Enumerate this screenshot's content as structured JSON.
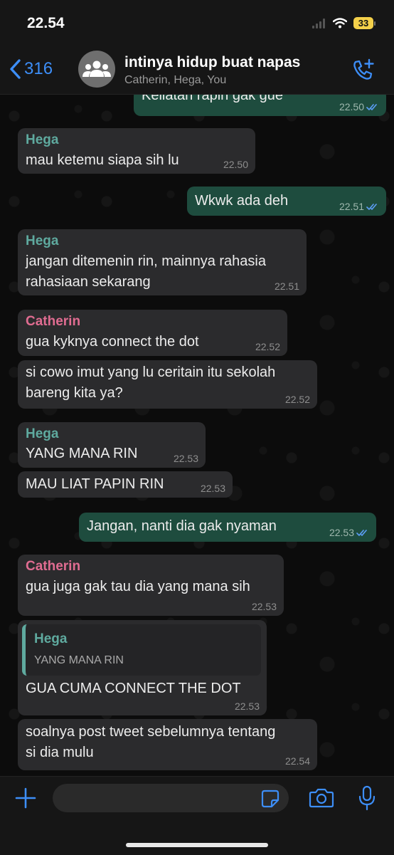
{
  "status": {
    "time": "22.54",
    "battery": "33"
  },
  "header": {
    "back_count": "316",
    "title": "intinya hidup buat napas",
    "subtitle": "Catherin, Hega, You"
  },
  "messages": [
    {
      "dir": "out",
      "lines": [
        "Keliatan rapih gak gue"
      ],
      "time": "22.50"
    },
    {
      "dir": "in",
      "sender": "Hega",
      "lines": [
        "mau ketemu siapa sih lu"
      ],
      "time": "22.50"
    },
    {
      "dir": "out",
      "lines": [
        "Wkwk ada deh"
      ],
      "time": "22.51"
    },
    {
      "dir": "in",
      "sender": "Hega",
      "lines": [
        "jangan ditemenin rin, mainnya rahasia",
        "rahasiaan sekarang"
      ],
      "time": "22.51"
    },
    {
      "dir": "in",
      "sender": "Catherin",
      "lines": [
        "gua kyknya connect the dot"
      ],
      "time": "22.52"
    },
    {
      "dir": "in",
      "lines": [
        "si cowo imut yang lu ceritain itu sekolah",
        "bareng kita ya?"
      ],
      "time": "22.52"
    },
    {
      "dir": "in",
      "sender": "Hega",
      "lines": [
        "YANG MANA RIN"
      ],
      "time": "22.53"
    },
    {
      "dir": "in",
      "lines": [
        "MAU LIAT PAPIN RIN"
      ],
      "time": "22.53"
    },
    {
      "dir": "out",
      "lines": [
        "Jangan, nanti dia gak nyaman"
      ],
      "time": "22.53"
    },
    {
      "dir": "in",
      "sender": "Catherin",
      "lines": [
        "gua juga gak tau dia yang mana sih"
      ],
      "time": "22.53"
    },
    {
      "dir": "in",
      "quote": {
        "sender": "Hega",
        "text": "YANG MANA RIN"
      },
      "lines": [
        "GUA CUMA CONNECT THE DOT"
      ],
      "time": "22.53"
    },
    {
      "dir": "in",
      "lines": [
        "soalnya post tweet sebelumnya tentang",
        "si dia mulu"
      ],
      "time": "22.54"
    }
  ],
  "composer": {
    "placeholder": ""
  },
  "colors": {
    "accent": "#3d8ef7",
    "outgoing": "#1e4c3e",
    "incoming": "#2b2b2d",
    "hega": "#5faa9f",
    "catherin": "#e06c91"
  },
  "icons": [
    "signal-icon",
    "wifi-icon",
    "battery-icon",
    "back-chevron-icon",
    "group-avatar-icon",
    "add-call-icon",
    "double-check-icon",
    "plus-icon",
    "sticker-icon",
    "camera-icon",
    "mic-icon"
  ]
}
